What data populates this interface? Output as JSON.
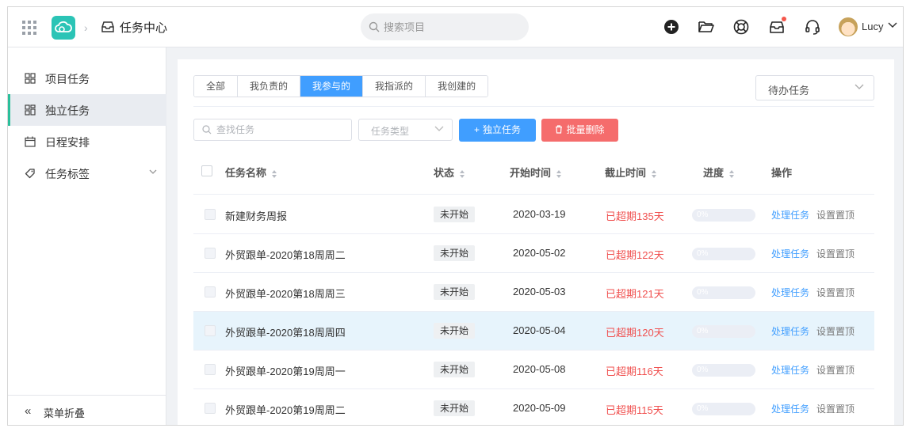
{
  "header": {
    "app_title": "任务中心",
    "search_placeholder": "搜索项目",
    "user_name": "Lucy",
    "icons": [
      "add-circle-icon",
      "folder-open-icon",
      "lifebuoy-icon",
      "inbox-notification-icon",
      "headset-icon"
    ],
    "accent_color": "#2bc4b6"
  },
  "sidebar": {
    "items": [
      {
        "label": "项目任务",
        "icon": "grid-icon",
        "active": false
      },
      {
        "label": "独立任务",
        "icon": "split-grid-icon",
        "active": true
      },
      {
        "label": "日程安排",
        "icon": "calendar-icon",
        "active": false
      },
      {
        "label": "任务标签",
        "icon": "tag-icon",
        "active": false,
        "expandable": true
      }
    ],
    "collapse_label": "菜单折叠"
  },
  "main": {
    "tabs": [
      {
        "label": "全部",
        "active": false
      },
      {
        "label": "我负责的",
        "active": false
      },
      {
        "label": "我参与的",
        "active": true
      },
      {
        "label": "我指派的",
        "active": false
      },
      {
        "label": "我创建的",
        "active": false
      }
    ],
    "filter_select": "待办任务",
    "toolbar": {
      "search_placeholder": "查找任务",
      "type_placeholder": "任务类型",
      "add_button": "独立任务",
      "delete_button": "批量删除"
    },
    "table": {
      "columns": [
        "任务名称",
        "状态",
        "开始时间",
        "截止时间",
        "进度",
        "操作"
      ],
      "rows": [
        {
          "name": "新建财务周报",
          "status": "未开始",
          "start": "2020-03-19",
          "deadline": "已超期135天",
          "progress": "0%",
          "action1": "处理任务",
          "action2": "设置置顶"
        },
        {
          "name": "外贸跟单-2020第18周周二",
          "status": "未开始",
          "start": "2020-05-02",
          "deadline": "已超期122天",
          "progress": "0%",
          "action1": "处理任务",
          "action2": "设置置顶"
        },
        {
          "name": "外贸跟单-2020第18周周三",
          "status": "未开始",
          "start": "2020-05-03",
          "deadline": "已超期121天",
          "progress": "0%",
          "action1": "处理任务",
          "action2": "设置置顶"
        },
        {
          "name": "外贸跟单-2020第18周周四",
          "status": "未开始",
          "start": "2020-05-04",
          "deadline": "已超期120天",
          "progress": "0%",
          "action1": "处理任务",
          "action2": "设置置顶",
          "highlighted": true
        },
        {
          "name": "外贸跟单-2020第19周周一",
          "status": "未开始",
          "start": "2020-05-08",
          "deadline": "已超期116天",
          "progress": "0%",
          "action1": "处理任务",
          "action2": "设置置顶"
        },
        {
          "name": "外贸跟单-2020第19周周二",
          "status": "未开始",
          "start": "2020-05-09",
          "deadline": "已超期115天",
          "progress": "0%",
          "action1": "处理任务",
          "action2": "设置置顶"
        }
      ]
    }
  }
}
